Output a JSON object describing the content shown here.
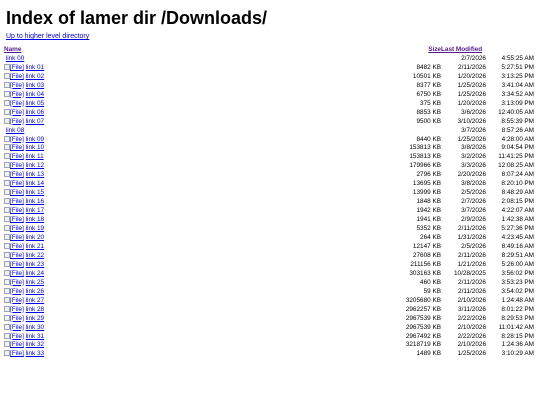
{
  "page": {
    "title": "Index of lamer dir /Downloads/",
    "up_link": "Up to higher level directory"
  },
  "table": {
    "headers": {
      "name": "Name",
      "size": "Size",
      "modified": "Last Modified"
    },
    "icon_alt": "[File]",
    "rows": [
      {
        "name": "link 00",
        "size": "",
        "date": "2/7/2026",
        "time": "4:55:25 AM",
        "dir": true
      },
      {
        "name": "link 01",
        "size": "8482 KB",
        "date": "2/11/2026",
        "time": "5:27:51 PM"
      },
      {
        "name": "link 02",
        "size": "10501 KB",
        "date": "1/20/2026",
        "time": "3:13:25 PM"
      },
      {
        "name": "link 03",
        "size": "8377 KB",
        "date": "1/25/2026",
        "time": "3:41:04 AM"
      },
      {
        "name": "link 04",
        "size": "6750 KB",
        "date": "1/25/2026",
        "time": "3:34:52 AM"
      },
      {
        "name": "link 05",
        "size": "375 KB",
        "date": "1/20/2026",
        "time": "3:13:09 PM"
      },
      {
        "name": "link 06",
        "size": "8853 KB",
        "date": "3/6/2026",
        "time": "12:40:05 AM"
      },
      {
        "name": "link 07",
        "size": "9500 KB",
        "date": "3/10/2026",
        "time": "8:55:39 PM"
      },
      {
        "name": "link 08",
        "size": "",
        "date": "3/7/2026",
        "time": "8:57:26 AM",
        "dir": true
      },
      {
        "name": "link 09",
        "size": "8440 KB",
        "date": "1/25/2026",
        "time": "4:28:00 AM"
      },
      {
        "name": "link 10",
        "size": "153813 KB",
        "date": "3/8/2026",
        "time": "9:04:54 PM"
      },
      {
        "name": "link 11",
        "size": "153813 KB",
        "date": "3/2/2026",
        "time": "11:41:25 PM"
      },
      {
        "name": "link 12",
        "size": "179966 KB",
        "date": "3/3/2026",
        "time": "12:08:25 AM"
      },
      {
        "name": "link 13",
        "size": "2796 KB",
        "date": "2/20/2026",
        "time": "8:07:24 AM"
      },
      {
        "name": "link 14",
        "size": "13695 KB",
        "date": "3/8/2026",
        "time": "8:20:10 PM"
      },
      {
        "name": "link 15",
        "size": "13999 KB",
        "date": "2/5/2026",
        "time": "8:48:29 AM"
      },
      {
        "name": "link 16",
        "size": "1848 KB",
        "date": "2/7/2026",
        "time": "2:08:15 PM"
      },
      {
        "name": "link 17",
        "size": "1942 KB",
        "date": "3/7/2026",
        "time": "4:22:07 AM"
      },
      {
        "name": "link 18",
        "size": "1941 KB",
        "date": "2/9/2026",
        "time": "1:42:38 AM"
      },
      {
        "name": "link 19",
        "size": "5352 KB",
        "date": "2/11/2026",
        "time": "5:27:36 PM"
      },
      {
        "name": "link 20",
        "size": "264 KB",
        "date": "1/31/2026",
        "time": "4:23:45 AM"
      },
      {
        "name": "link 21",
        "size": "12147 KB",
        "date": "2/5/2026",
        "time": "8:49:16 AM"
      },
      {
        "name": "link 22",
        "size": "27608 KB",
        "date": "2/11/2026",
        "time": "8:29:51 AM"
      },
      {
        "name": "link 23",
        "size": "211156 KB",
        "date": "1/21/2026",
        "time": "5:26:00 AM"
      },
      {
        "name": "link 24",
        "size": "303163 KB",
        "date": "10/28/2025",
        "time": "3:56:02 PM"
      },
      {
        "name": "link 25",
        "size": "460 KB",
        "date": "2/11/2026",
        "time": "3:53:23 PM"
      },
      {
        "name": "link 26",
        "size": "59 KB",
        "date": "2/11/2026",
        "time": "3:54:02 PM"
      },
      {
        "name": "link 27",
        "size": "3205680 KB",
        "date": "2/10/2026",
        "time": "1:24:48 AM"
      },
      {
        "name": "link 28",
        "size": "2962257 KB",
        "date": "3/11/2026",
        "time": "8:01:22 PM"
      },
      {
        "name": "link 29",
        "size": "2967539 KB",
        "date": "2/22/2026",
        "time": "8:29:53 PM"
      },
      {
        "name": "link 30",
        "size": "2967539 KB",
        "date": "2/10/2026",
        "time": "11:01:42 AM"
      },
      {
        "name": "link 31",
        "size": "2967492 KB",
        "date": "2/22/2026",
        "time": "8:28:15 PM"
      },
      {
        "name": "link 32",
        "size": "3218719 KB",
        "date": "2/10/2026",
        "time": "1:24:36 AM"
      },
      {
        "name": "link 33",
        "size": "1489 KB",
        "date": "1/25/2026",
        "time": "3:10:29 AM"
      }
    ]
  }
}
